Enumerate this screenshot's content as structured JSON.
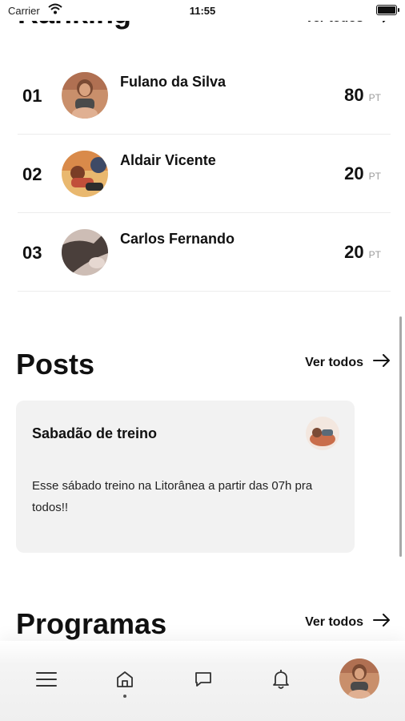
{
  "status_bar": {
    "carrier": "Carrier",
    "time": "11:55"
  },
  "ranking": {
    "title": "Ranking",
    "see_all": "Ver todos",
    "entries": [
      {
        "position": "01",
        "name": "Fulano da Silva",
        "points": "80",
        "unit": "PT"
      },
      {
        "position": "02",
        "name": "Aldair Vicente",
        "points": "20",
        "unit": "PT"
      },
      {
        "position": "03",
        "name": "Carlos Fernando",
        "points": "20",
        "unit": "PT"
      }
    ]
  },
  "posts": {
    "title": "Posts",
    "see_all": "Ver todos",
    "items": [
      {
        "title": "Sabadão de treino",
        "body": "Esse sábado treino na Litorânea a partir das 07h pra todos!!"
      }
    ]
  },
  "programs": {
    "title": "Programas",
    "see_all": "Ver todos"
  },
  "tab_bar": {
    "items": [
      {
        "icon": "menu-icon"
      },
      {
        "icon": "home-icon",
        "active": true
      },
      {
        "icon": "chat-icon"
      },
      {
        "icon": "bell-icon"
      },
      {
        "icon": "profile-avatar"
      }
    ]
  },
  "colors": {
    "card_bg": "#f2f2f2",
    "muted_text": "#9a9a9a",
    "text": "#111111"
  }
}
